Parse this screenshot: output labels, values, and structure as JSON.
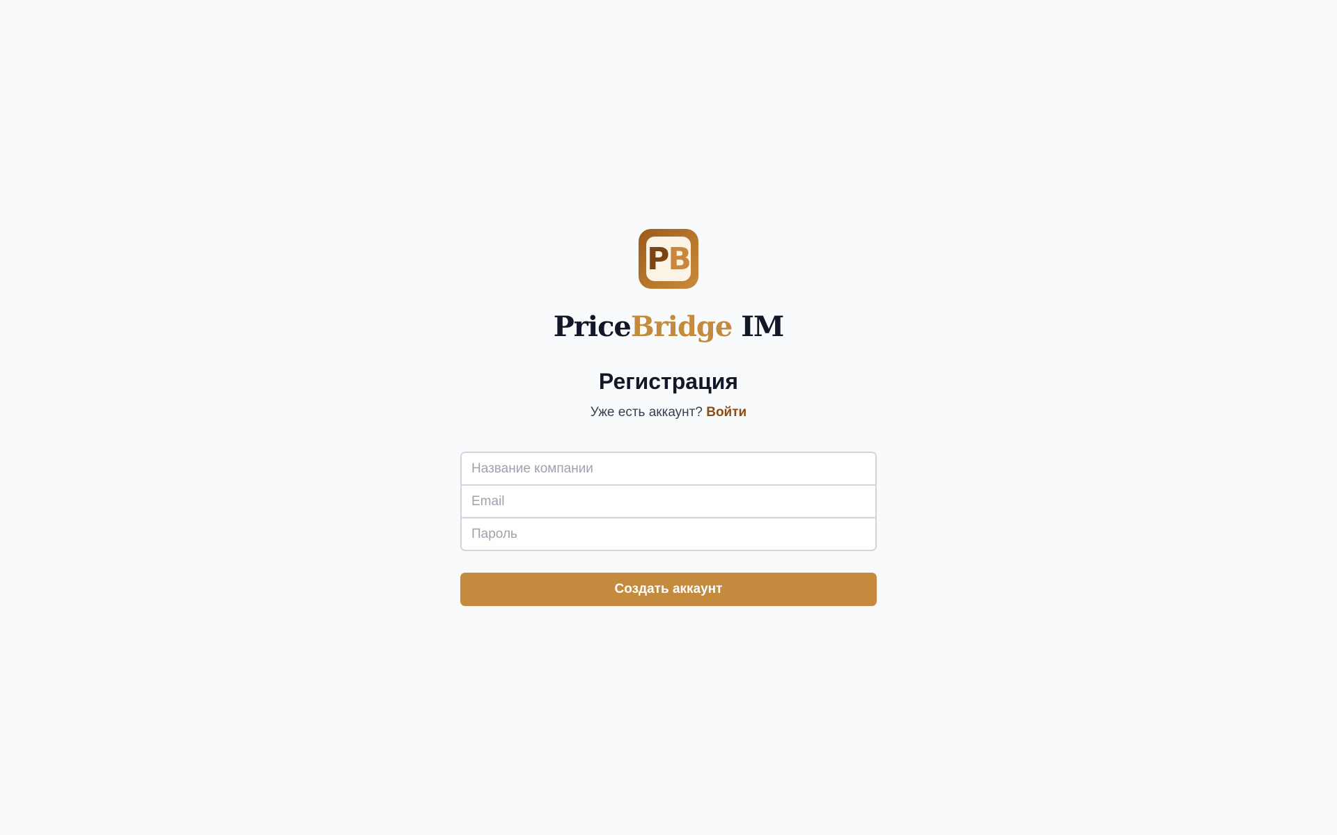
{
  "logo": {
    "letter_p": "P",
    "letter_b": "B",
    "icon": "pricebridge-logo-icon"
  },
  "brand": {
    "part1": "Price",
    "part2": "Bridge",
    "part3": " IM"
  },
  "auth": {
    "title": "Регистрация",
    "prompt": "Уже есть аккаунт?",
    "login_link": "Войти"
  },
  "form": {
    "company_placeholder": "Название компании",
    "email_placeholder": "Email",
    "password_placeholder": "Пароль",
    "submit_label": "Создать аккаунт"
  },
  "colors": {
    "accent": "#c48a3d",
    "accent_dark": "#8a4e12",
    "background": "#f9fafb",
    "text": "#111827"
  }
}
